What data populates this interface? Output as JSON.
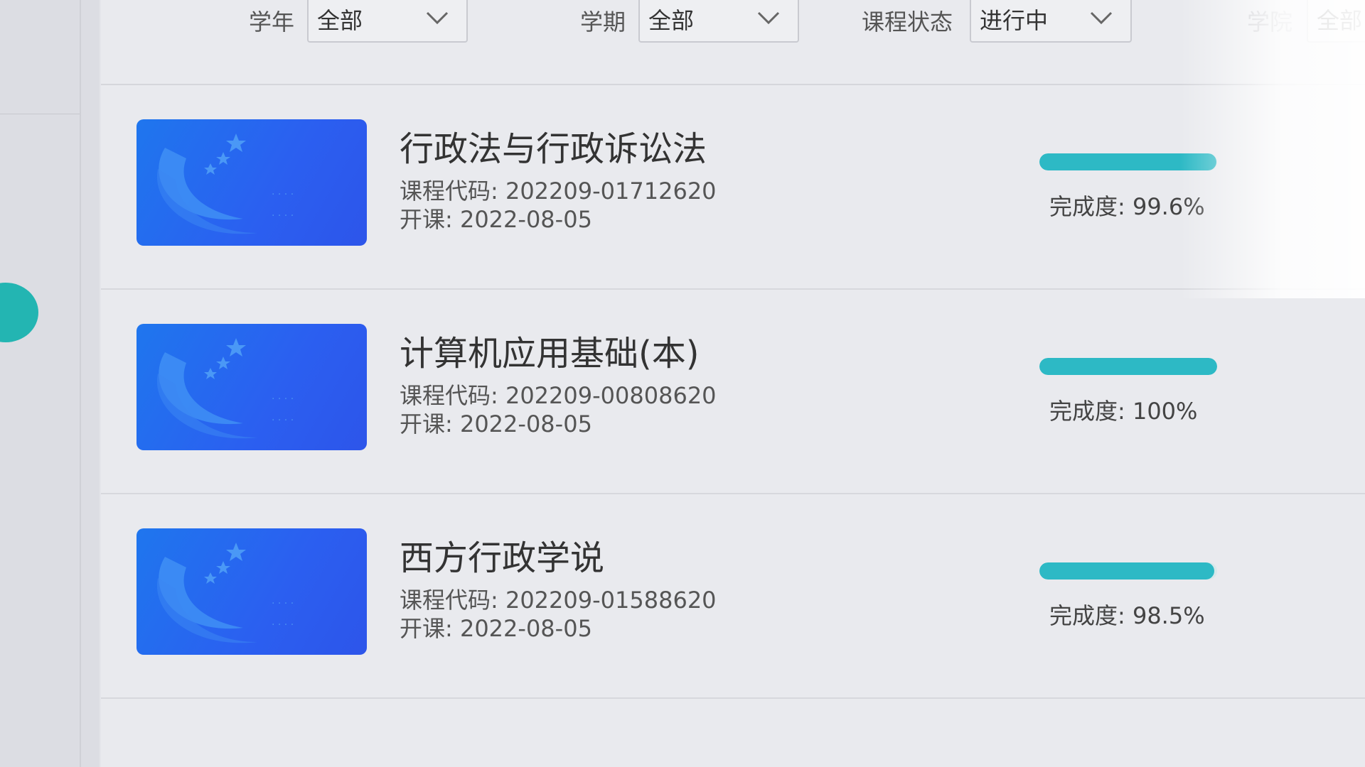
{
  "filters": {
    "year": {
      "label": "学年",
      "value": "全部"
    },
    "term": {
      "label": "学期",
      "value": "全部"
    },
    "status": {
      "label": "课程状态",
      "value": "进行中"
    },
    "college": {
      "label": "学院",
      "value": "全部"
    }
  },
  "courses": [
    {
      "title": "行政法与行政诉讼法",
      "code": "课程代码: 202209-01712620",
      "start": "开课: 2022-08-05",
      "progress_text": "完成度: 99.6%",
      "progress": 99.6
    },
    {
      "title": "计算机应用基础(本)",
      "code": "课程代码: 202209-00808620",
      "start": "开课: 2022-08-05",
      "progress_text": "完成度: 100%",
      "progress": 100
    },
    {
      "title": "西方行政学说",
      "code": "课程代码: 202209-01588620",
      "start": "开课: 2022-08-05",
      "progress_text": "完成度: 98.5%",
      "progress": 98.5
    }
  ],
  "colors": {
    "accent": "#2db9c5",
    "thumbnail": "#2b5ff0",
    "side_indicator": "#23b5b2"
  },
  "icons": {
    "dropdown": "chevron-down-icon",
    "thumbnail": "course-cover-logo"
  }
}
